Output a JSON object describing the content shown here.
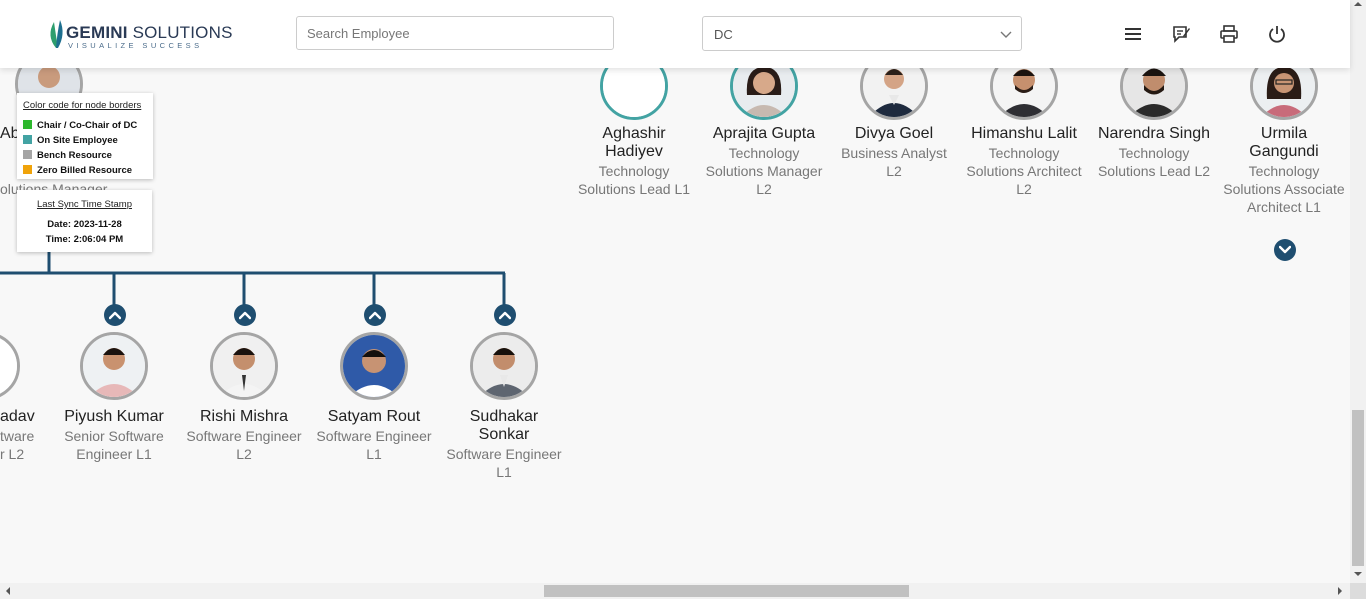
{
  "header": {
    "logo_main_bold": "GEMINI",
    "logo_main_rest": " SOLUTIONS",
    "logo_tagline": "VISUALIZE SUCCESS",
    "search_placeholder": "Search Employee",
    "select_value": "DC",
    "icons": [
      "menu-icon",
      "feedback-icon",
      "print-icon",
      "power-icon"
    ]
  },
  "top_row": [
    {
      "name": "Aghashir Hadiyev",
      "title": "Technology Solutions Lead L1"
    },
    {
      "name": "Aprajita Gupta",
      "title": "Technology Solutions Manager L2"
    },
    {
      "name": "Divya Goel",
      "title": "Business Analyst L2"
    },
    {
      "name": "Himanshu Lalit",
      "title": "Technology Solutions Architect L2"
    },
    {
      "name": "Narendra Singh",
      "title": "Technology Solutions Lead L2"
    },
    {
      "name": "Urmila Gangundi",
      "title": "Technology Solutions Associate Architect L1"
    }
  ],
  "partial_left": {
    "name_fragment": "Ab",
    "title_fragment": "olutions Manager"
  },
  "bottom_row": [
    {
      "name": "adav",
      "title": "tware r L2"
    },
    {
      "name": "Piyush Kumar",
      "title": "Senior Software Engineer L1"
    },
    {
      "name": "Rishi Mishra",
      "title": "Software Engineer L2"
    },
    {
      "name": "Satyam Rout",
      "title": "Software Engineer L1"
    },
    {
      "name": "Sudhakar Sonkar",
      "title": "Software Engineer L1"
    }
  ],
  "legend": {
    "title": "Color code for node borders",
    "items": [
      {
        "label": "Chair / Co-Chair of DC",
        "color": "#2db82d"
      },
      {
        "label": "On Site Employee",
        "color": "#43a3a3"
      },
      {
        "label": "Bench Resource",
        "color": "#a5a5a5"
      },
      {
        "label": "Zero Billed Resource",
        "color": "#f0a30a"
      }
    ]
  },
  "sync": {
    "title": "Last Sync Time Stamp",
    "date": "Date: 2023-11-28",
    "time": "Time: 2:06:04 PM"
  },
  "colors": {
    "connector": "#1f4e70",
    "teal_border": "#43a3a3",
    "grey_border": "#a5a5a5"
  }
}
